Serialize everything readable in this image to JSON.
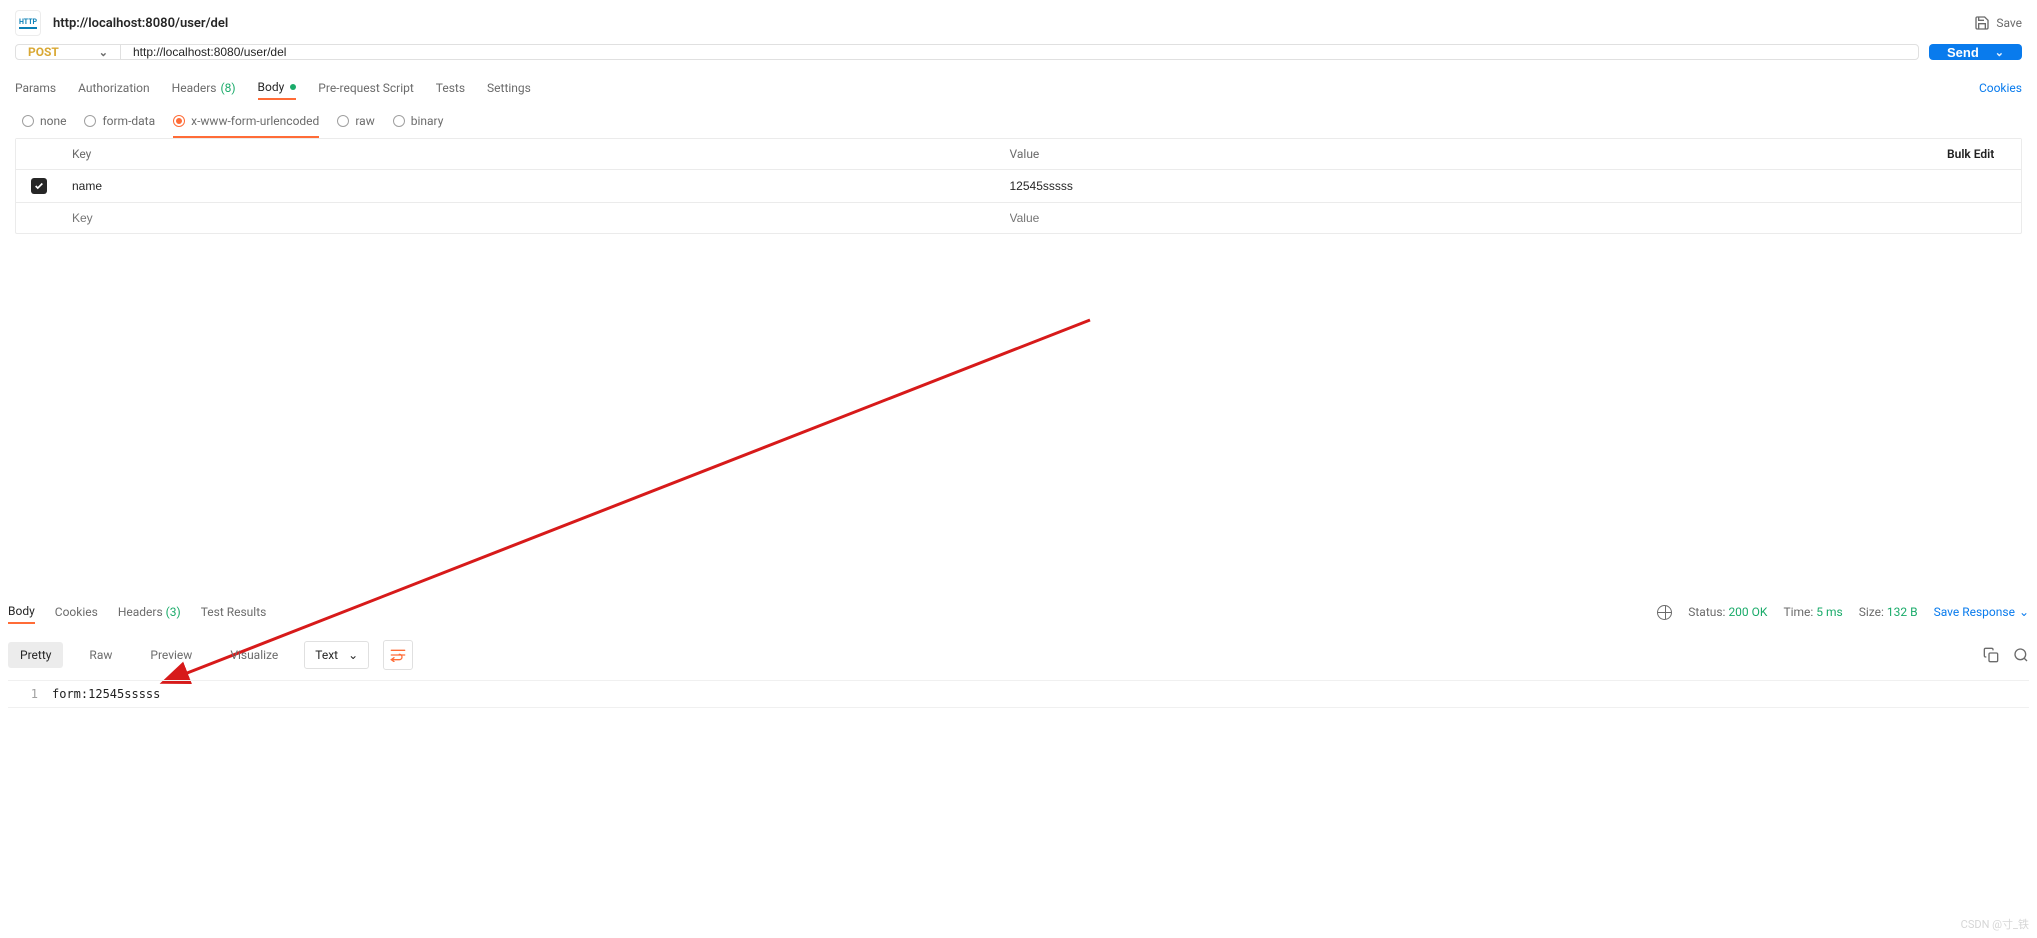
{
  "header": {
    "tabTitle": "http://localhost:8080/user/del",
    "saveLabel": "Save"
  },
  "request": {
    "method": "POST",
    "url": "http://localhost:8080/user/del",
    "sendLabel": "Send"
  },
  "reqTabs": {
    "params": "Params",
    "authorization": "Authorization",
    "headers": "Headers",
    "headersCount": "(8)",
    "body": "Body",
    "prerequest": "Pre-request Script",
    "tests": "Tests",
    "settings": "Settings",
    "cookies": "Cookies"
  },
  "bodyTypes": {
    "none": "none",
    "formdata": "form-data",
    "urlencoded": "x-www-form-urlencoded",
    "raw": "raw",
    "binary": "binary"
  },
  "kvTable": {
    "keyHeader": "Key",
    "valueHeader": "Value",
    "bulkEdit": "Bulk Edit",
    "rowKey": "name",
    "rowValue": "12545sssss",
    "keyPlaceholder": "Key",
    "valuePlaceholder": "Value"
  },
  "resTabs": {
    "body": "Body",
    "cookies": "Cookies",
    "headers": "Headers",
    "headersCount": "(3)",
    "testResults": "Test Results"
  },
  "meta": {
    "statusLabel": "Status:",
    "statusValue": "200 OK",
    "timeLabel": "Time:",
    "timeValue": "5 ms",
    "sizeLabel": "Size:",
    "sizeValue": "132 B",
    "saveResponse": "Save Response"
  },
  "format": {
    "pretty": "Pretty",
    "raw": "Raw",
    "preview": "Preview",
    "visualize": "Visualize",
    "typeSel": "Text"
  },
  "code": {
    "lineNo": "1",
    "content": "form:12545sssss"
  },
  "watermark": "CSDN @寸_铁"
}
